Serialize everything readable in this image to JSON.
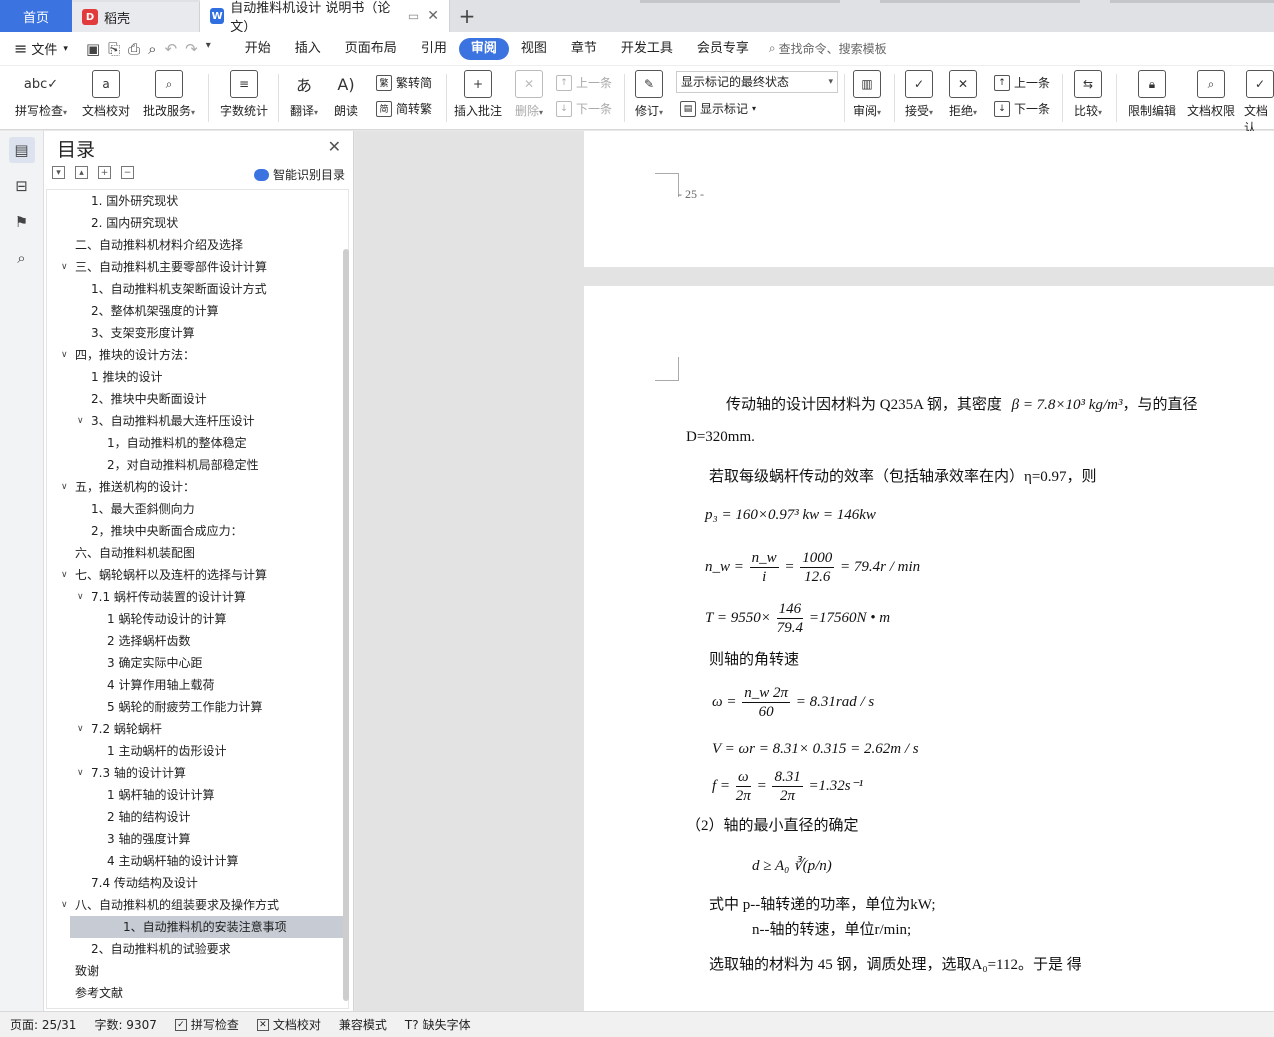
{
  "tabs": {
    "home": "首页",
    "daoke": "稻壳",
    "doc": "自动推料机设计 说明书（论文）"
  },
  "menu": {
    "file": "文件",
    "items": [
      "开始",
      "插入",
      "页面布局",
      "引用",
      "审阅",
      "视图",
      "章节",
      "开发工具",
      "会员专享"
    ],
    "active": "审阅",
    "search": "查找命令、搜索模板"
  },
  "ribbon": {
    "spellcheck": "拼写检查",
    "doccheck": "文档校对",
    "batch": "批改服务",
    "wordcount": "字数统计",
    "translate": "翻译",
    "read": "朗读",
    "simp2trad": "繁转简",
    "trad2simp": "简转繁",
    "insert_comment": "插入批注",
    "delete": "删除",
    "prev_comment": "上一条",
    "next_comment": "下一条",
    "track": "修订",
    "markup_state": "显示标记的最终状态",
    "show_markup": "显示标记",
    "review": "审阅",
    "accept": "接受",
    "reject": "拒绝",
    "prev_change": "上一条",
    "next_change": "下一条",
    "compare": "比较",
    "restrict": "限制编辑",
    "rights": "文档权限",
    "docauth": "文档认"
  },
  "toc": {
    "title": "目录",
    "smart": "智能识别目录",
    "items": [
      {
        "text": "1. 国外研究现状",
        "indent": 2,
        "tgl": ""
      },
      {
        "text": "2. 国内研究现状",
        "indent": 2,
        "tgl": ""
      },
      {
        "text": "二、自动推料机材料介绍及选择",
        "indent": 1,
        "tgl": ""
      },
      {
        "text": "三、自动推料机主要零部件设计计算",
        "indent": 1,
        "tgl": "v"
      },
      {
        "text": "1、自动推料机支架断面设计方式",
        "indent": 2,
        "tgl": ""
      },
      {
        "text": "2、整体机架强度的计算",
        "indent": 2,
        "tgl": ""
      },
      {
        "text": "3、支架变形度计算",
        "indent": 2,
        "tgl": ""
      },
      {
        "text": "四，推块的设计方法：",
        "indent": 1,
        "tgl": "v"
      },
      {
        "text": "1 推块的设计",
        "indent": 2,
        "tgl": ""
      },
      {
        "text": "2、推块中央断面设计",
        "indent": 2,
        "tgl": ""
      },
      {
        "text": "3、自动推料机最大连杆压设计",
        "indent": 2,
        "tgl": "v"
      },
      {
        "text": "1，自动推料机的整体稳定",
        "indent": 3,
        "tgl": ""
      },
      {
        "text": "2，对自动推料机局部稳定性",
        "indent": 3,
        "tgl": ""
      },
      {
        "text": "五，推送机构的设计：",
        "indent": 1,
        "tgl": "v"
      },
      {
        "text": "1、最大歪斜侧向力",
        "indent": 2,
        "tgl": ""
      },
      {
        "text": "2，推块中央断面合成应力：",
        "indent": 2,
        "tgl": ""
      },
      {
        "text": "六、自动推料机装配图",
        "indent": 1,
        "tgl": ""
      },
      {
        "text": "七、蜗轮蜗杆以及连杆的选择与计算",
        "indent": 1,
        "tgl": "v"
      },
      {
        "text": "7.1  蜗杆传动装置的设计计算",
        "indent": 2,
        "tgl": "v"
      },
      {
        "text": "1  蜗轮传动设计的计算",
        "indent": 3,
        "tgl": ""
      },
      {
        "text": "2  选择蜗杆齿数",
        "indent": 3,
        "tgl": ""
      },
      {
        "text": "3  确定实际中心距",
        "indent": 3,
        "tgl": ""
      },
      {
        "text": "4  计算作用轴上载荷",
        "indent": 3,
        "tgl": ""
      },
      {
        "text": "5  蜗轮的耐疲劳工作能力计算",
        "indent": 3,
        "tgl": ""
      },
      {
        "text": "7.2    蜗轮蜗杆",
        "indent": 2,
        "tgl": "v"
      },
      {
        "text": "1  主动蜗杆的齿形设计",
        "indent": 3,
        "tgl": ""
      },
      {
        "text": "7.3    轴的设计计算",
        "indent": 2,
        "tgl": "v"
      },
      {
        "text": "1    蜗杆轴的设计计算",
        "indent": 3,
        "tgl": ""
      },
      {
        "text": "2  轴的结构设计",
        "indent": 3,
        "tgl": ""
      },
      {
        "text": "3    轴的强度计算",
        "indent": 3,
        "tgl": ""
      },
      {
        "text": "4  主动蜗杆轴的设计计算",
        "indent": 3,
        "tgl": ""
      },
      {
        "text": "7.4  传动结构及设计",
        "indent": 2,
        "tgl": ""
      },
      {
        "text": "八、自动推料机的组装要求及操作方式",
        "indent": 1,
        "tgl": "v"
      },
      {
        "text": "1、自动推料机的安装注意事项",
        "indent": 3,
        "tgl": "",
        "sel": true
      },
      {
        "text": "2、自动推料机的试验要求",
        "indent": 2,
        "tgl": ""
      },
      {
        "text": "致谢",
        "indent": 1,
        "tgl": ""
      },
      {
        "text": "参考文献",
        "indent": 1,
        "tgl": ""
      }
    ]
  },
  "doc": {
    "page_num": "- 25 -",
    "p1": "传动轴的设计因材料为 Q235A 钢，其密度",
    "p1_density": "β = 7.8×10³ kg/m³",
    "p1_tail": "，与的直径",
    "p2": "D=320mm.",
    "p3": "若取每级蜗杆传动的效率（包括轴承效率在内）η=0.97，则",
    "eq_p3": "p₃ = 160×0.97³ kw = 146kw",
    "eq_nw_lhs": "n_w =",
    "eq_nw_f1n": "n_w",
    "eq_nw_f1d": "i",
    "eq_nw_f2n": "1000",
    "eq_nw_f2d": "12.6",
    "eq_nw_rhs": "= 79.4r / min",
    "eq_T_lhs": "T = 9550×",
    "eq_T_fn": "146",
    "eq_T_fd": "79.4",
    "eq_T_rhs": "=17560N • m",
    "p4": "则轴的角转速",
    "eq_w_lhs": "ω =",
    "eq_w_fn": "n_w 2π",
    "eq_w_fd": "60",
    "eq_w_rhs": "= 8.31rad / s",
    "eq_V": "V = ωr = 8.31× 0.315 = 2.62m / s",
    "eq_f_lhs": "f =",
    "eq_f_f1n": "ω",
    "eq_f_f1d": "2π",
    "eq_f_f2n": "8.31",
    "eq_f_f2d": "2π",
    "eq_f_rhs": "=1.32s⁻¹",
    "p5": "（2）轴的最小直径的确定",
    "eq_d": "d ≥ A₀ ∛(p/n)",
    "p6a": "式中   p--轴转递的功率，单位为kW;",
    "p6b": "n--轴的转速，单位r/min;",
    "p7": "选取轴的材料为 45 钢，调质处理，选取A₀=112。于是  得"
  },
  "status": {
    "page": "页面: 25/31",
    "words": "字数: 9307",
    "spell": "拼写检查",
    "proof": "文档校对",
    "compat": "兼容模式",
    "missing_font": "缺失字体"
  }
}
